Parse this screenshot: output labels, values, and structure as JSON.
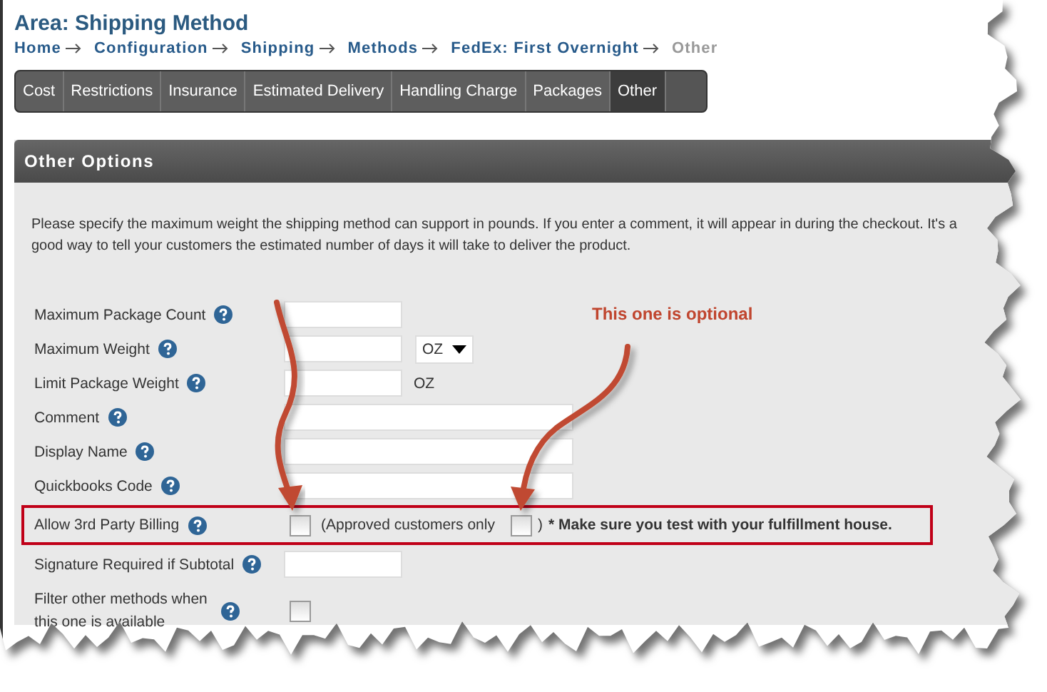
{
  "title": "Area: Shipping Method",
  "breadcrumbs": [
    {
      "label": "Home",
      "current": false
    },
    {
      "label": "Configuration",
      "current": false
    },
    {
      "label": "Shipping",
      "current": false
    },
    {
      "label": "Methods",
      "current": false
    },
    {
      "label": "FedEx: First Overnight",
      "current": false
    },
    {
      "label": "Other",
      "current": true
    }
  ],
  "tabs": [
    {
      "label": "Cost",
      "selected": false
    },
    {
      "label": "Restrictions",
      "selected": false
    },
    {
      "label": "Insurance",
      "selected": false
    },
    {
      "label": "Estimated Delivery",
      "selected": false
    },
    {
      "label": "Handling Charge",
      "selected": false
    },
    {
      "label": "Packages",
      "selected": false
    },
    {
      "label": "Other",
      "selected": true
    }
  ],
  "panel": {
    "title": "Other Options",
    "description": "Please specify the maximum weight the shipping method can support in pounds. If you enter a comment, it will appear in during the checkout. It's a good way to tell your customers the estimated number of days it will take to deliver the product."
  },
  "annotation": {
    "text": "This one is optional"
  },
  "fields": [
    {
      "kind": "text",
      "label": "Maximum Package Count",
      "highlighted": false
    },
    {
      "kind": "select",
      "label": "Maximum Weight",
      "unit": "OZ",
      "highlighted": false
    },
    {
      "kind": "unit",
      "label": "Limit Package Weight",
      "unit": "OZ",
      "highlighted": false
    },
    {
      "kind": "wide",
      "label": "Comment",
      "highlighted": false
    },
    {
      "kind": "wide",
      "label": "Display Name",
      "highlighted": false
    },
    {
      "kind": "wide",
      "label": "Quickbooks Code",
      "highlighted": false
    },
    {
      "kind": "billing",
      "label": "Allow 3rd Party Billing",
      "checked": false,
      "note_open": "(Approved customers only",
      "approved_checked": false,
      "note_close": ")",
      "warning": "* Make sure you test with your fulfillment house.",
      "highlighted": true
    },
    {
      "kind": "text",
      "label": "Signature Required if Subtotal",
      "highlighted": false
    },
    {
      "kind": "checkbox",
      "label": "Filter other methods when this one is available",
      "checked": false,
      "highlighted": false
    }
  ]
}
